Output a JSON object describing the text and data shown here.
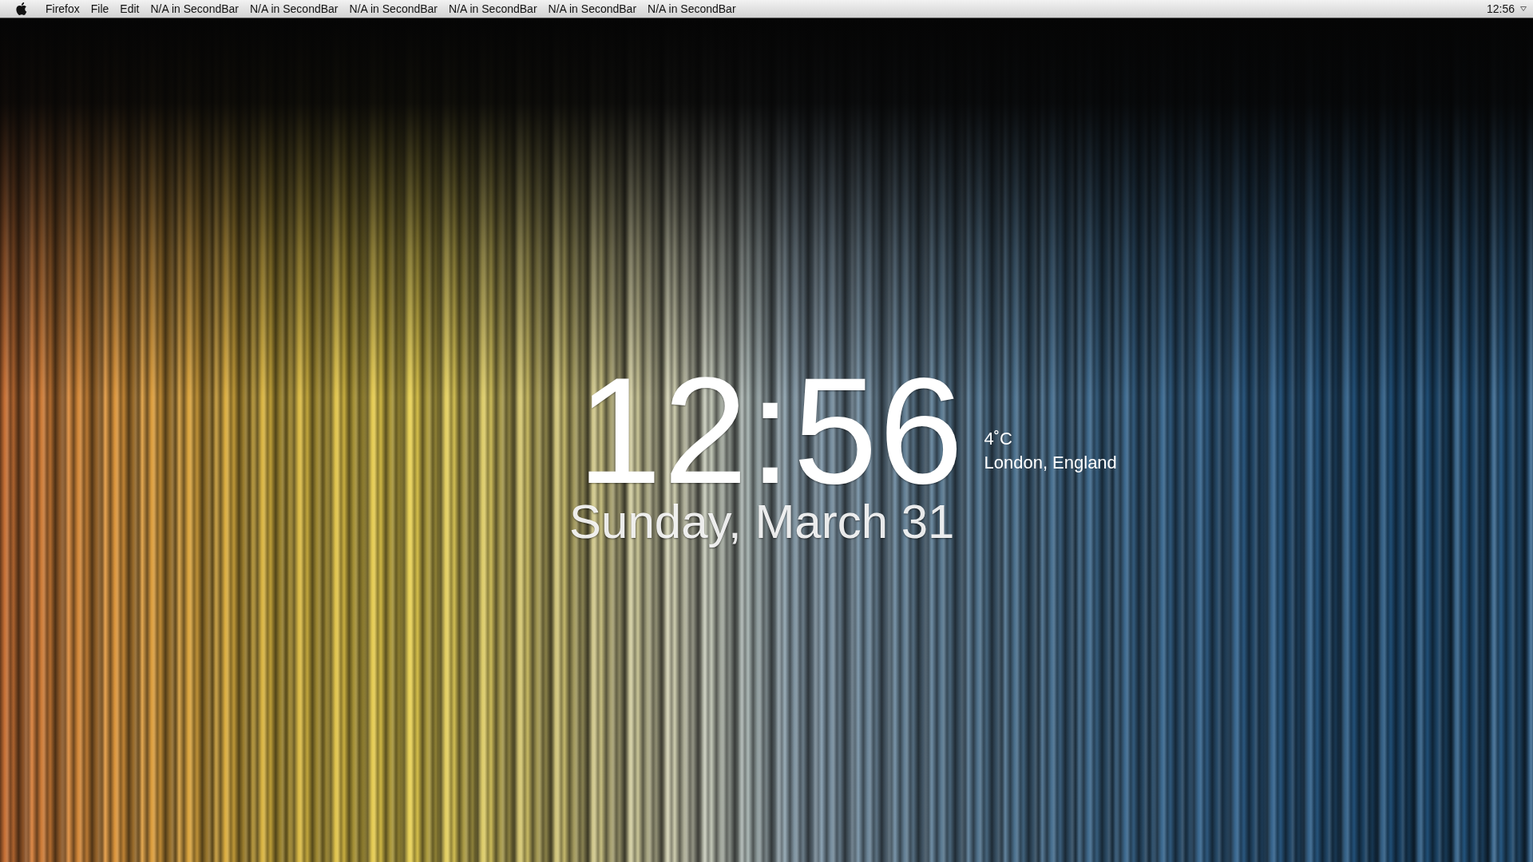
{
  "menu_bar": {
    "app_name": "Firefox",
    "menus": [
      "File",
      "Edit",
      "N/A in SecondBar",
      "N/A in SecondBar",
      "N/A in SecondBar",
      "N/A in SecondBar",
      "N/A in SecondBar",
      "N/A in SecondBar"
    ],
    "clock": "12:56"
  },
  "clock_widget": {
    "time": "12:56",
    "date": "Sunday, March 31",
    "temperature": "4˚C",
    "location": "London, England"
  }
}
